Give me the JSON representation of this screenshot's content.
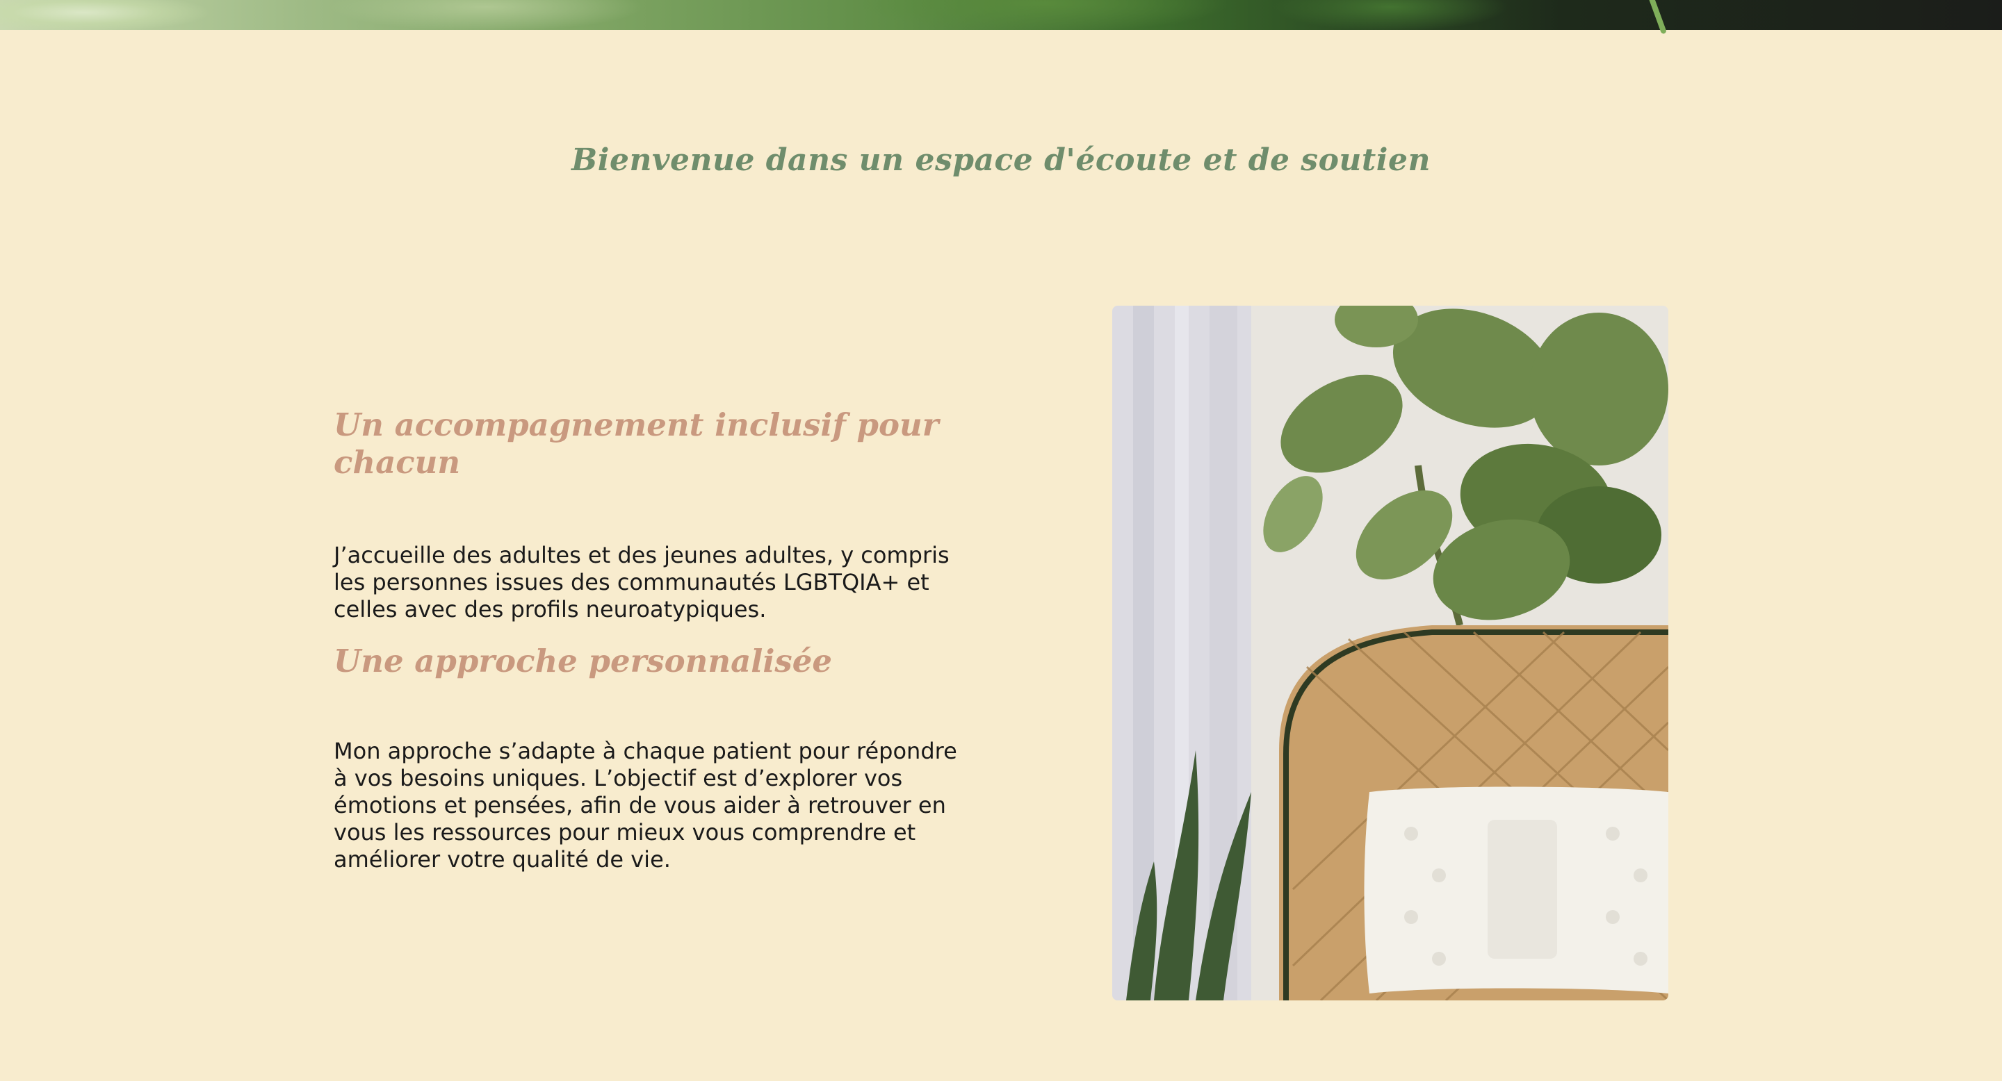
{
  "welcome": {
    "title": "Bienvenue dans un espace d'écoute et de soutien"
  },
  "sections": [
    {
      "heading": "Un accompagnement inclusif pour chacun",
      "text": "J’accueille des adultes et des jeunes adultes, y compris les personnes issues des communautés LGBTQIA+ et celles avec des profils neuroatypiques."
    },
    {
      "heading": "Une approche personnalisée",
      "text": "Mon approche s’adapte à chaque patient pour répondre à vos besoins uniques. L’objectif est d’explorer vos émotions et pensées, afin de vous aider à retrouver en vous les ressources pour mieux vous comprendre et améliorer votre qualité de vie."
    }
  ],
  "colors": {
    "background": "#f8ecce",
    "title_green": "#6f8d6c",
    "heading_rose": "#c9997f",
    "body_text": "#1a1a1a"
  },
  "images": {
    "hero": "foliage-banner",
    "photo": "wicker-chair-plant-photo"
  }
}
